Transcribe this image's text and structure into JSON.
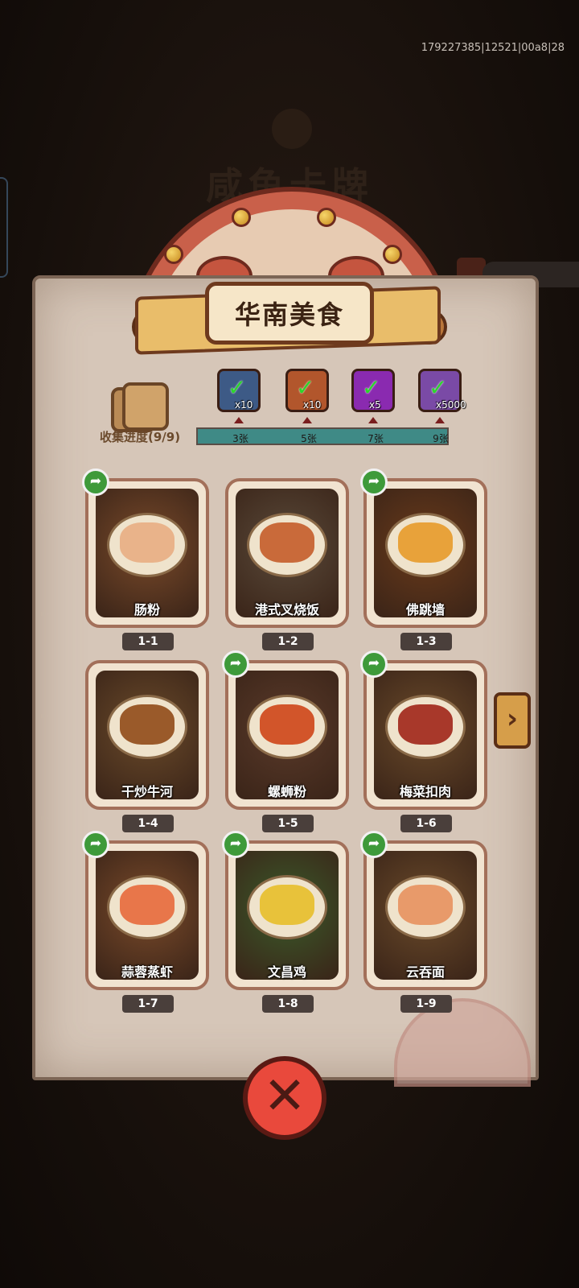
{
  "debug": "179227385|12521|00a8|28",
  "background_title": "咸鱼卡牌",
  "title": "华南美食",
  "progress": {
    "label": "收集进度(9/9)",
    "fraction": 1.0,
    "milestones": [
      {
        "label": "3张",
        "count": "x10",
        "icon": "blue-chest-icon",
        "color": "#3d5a86"
      },
      {
        "label": "5张",
        "count": "x10",
        "icon": "orange-key-icon",
        "color": "#b2562c"
      },
      {
        "label": "7张",
        "count": "x5",
        "icon": "purple-orb-icon",
        "color": "#8a2ab0"
      },
      {
        "label": "9张",
        "count": "x5000",
        "icon": "purple-crystal-icon",
        "color": "#7a4aa6"
      }
    ]
  },
  "cards": [
    {
      "name": "肠粉",
      "tag": "1-1",
      "shareable": true,
      "bg": "#7a4a2a",
      "food": "#e9b38a"
    },
    {
      "name": "港式叉烧饭",
      "tag": "1-2",
      "shareable": false,
      "bg": "#5a4a3a",
      "food": "#c96a3a"
    },
    {
      "name": "佛跳墙",
      "tag": "1-3",
      "shareable": true,
      "bg": "#6a3a1a",
      "food": "#e8a23a"
    },
    {
      "name": "干炒牛河",
      "tag": "1-4",
      "shareable": false,
      "bg": "#6a4a2a",
      "food": "#9a5a2a"
    },
    {
      "name": "螺蛳粉",
      "tag": "1-5",
      "shareable": true,
      "bg": "#5a3a2a",
      "food": "#d2552a"
    },
    {
      "name": "梅菜扣肉",
      "tag": "1-6",
      "shareable": true,
      "bg": "#6a4a2a",
      "food": "#a8382a"
    },
    {
      "name": "蒜蓉蒸虾",
      "tag": "1-7",
      "shareable": true,
      "bg": "#7a4a2a",
      "food": "#e8764a"
    },
    {
      "name": "文昌鸡",
      "tag": "1-8",
      "shareable": true,
      "bg": "#3a5a2a",
      "food": "#e8c23a"
    },
    {
      "name": "云吞面",
      "tag": "1-9",
      "shareable": true,
      "bg": "#6a4a2a",
      "food": "#e89a6a"
    }
  ]
}
